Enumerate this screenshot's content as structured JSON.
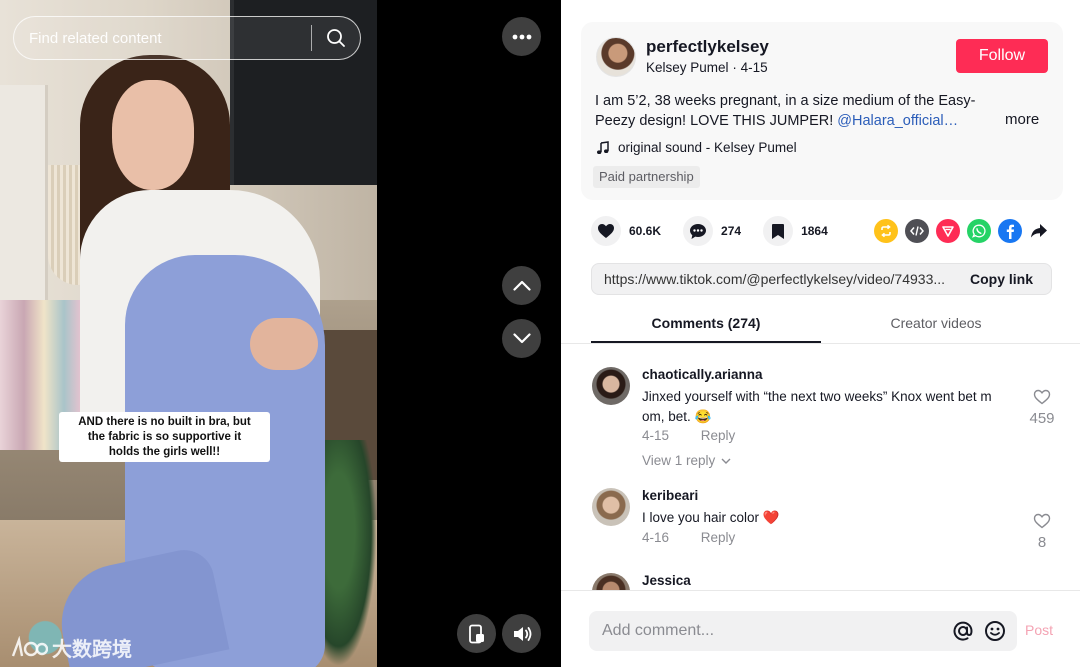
{
  "video": {
    "search_placeholder": "Find related content",
    "caption_lines": [
      "AND there is no built in bra, but",
      "the fabric is so supportive it",
      "holds the girls well!!"
    ],
    "watermark_text": "大数跨境",
    "icons": {
      "search": "search-icon",
      "more": "more-dots-icon",
      "prev": "chevron-up-icon",
      "next": "chevron-down-icon",
      "mini_player": "mini-player-icon",
      "volume": "volume-icon"
    }
  },
  "post": {
    "username": "perfectlykelsey",
    "display_name": "Kelsey Pumel",
    "date": "4-15",
    "follow_label": "Follow",
    "description_line1": "I am 5’2, 38 weeks pregnant, in a size medium of the Easy-",
    "description_line2_prefix": "Peezy design! LOVE THIS JUMPER! ",
    "description_mention": "@Halara_official…",
    "more_label": "more",
    "sound": "original sound - Kelsey Pumel",
    "paid_label": "Paid partnership"
  },
  "stats": {
    "likes": "60.6K",
    "comments": "274",
    "saves": "1864"
  },
  "share_colors": {
    "repost": "#ffc21a",
    "embed": "#4f4f55",
    "send": "#fe2c55",
    "whatsapp": "#25d366",
    "facebook": "#1877f2"
  },
  "link": {
    "url": "https://www.tiktok.com/@perfectlykelsey/video/74933...",
    "copy_label": "Copy link"
  },
  "tabs": [
    {
      "label": "Comments (274)",
      "active": true
    },
    {
      "label": "Creator videos",
      "active": false
    }
  ],
  "comments": [
    {
      "user": "chaotically.arianna",
      "text": "Jinxed yourself with “the next two weeks” Knox went bet m om, bet. 😂",
      "date": "4-15",
      "reply_label": "Reply",
      "likes": "459",
      "view_replies": "View 1 reply"
    },
    {
      "user": "keribeari",
      "text": "I love you hair color ❤️",
      "date": "4-16",
      "reply_label": "Reply",
      "likes": "8"
    },
    {
      "user": "Jessica"
    }
  ],
  "comment_bar": {
    "placeholder": "Add comment...",
    "post_label": "Post"
  },
  "colors": {
    "accent": "#fe2c55",
    "mention": "#2b5db9"
  }
}
